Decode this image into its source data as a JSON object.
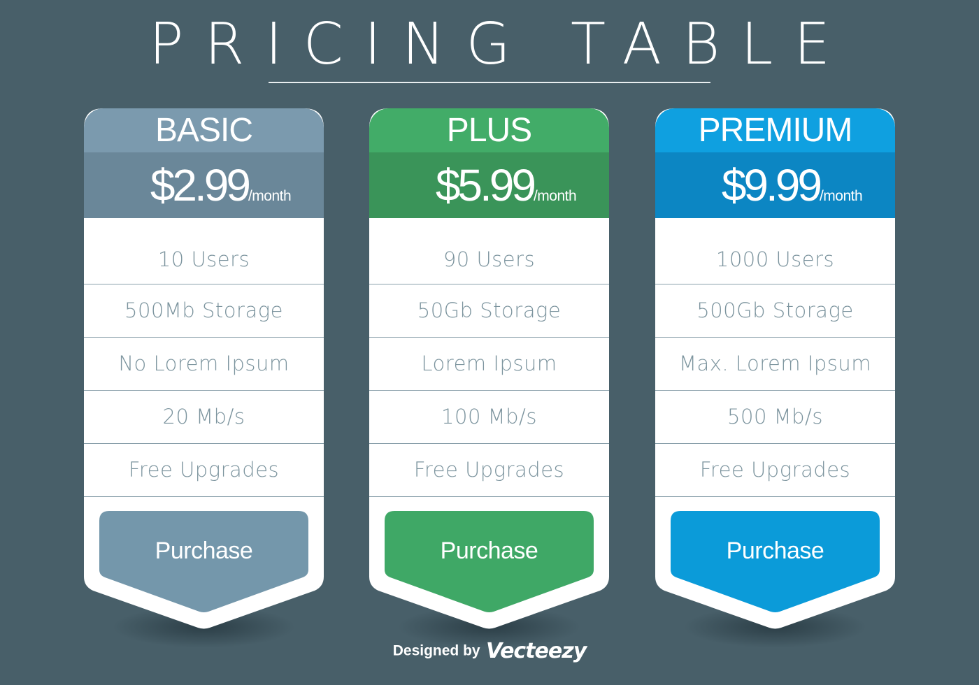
{
  "title": "PRICING TABLE",
  "plans": [
    {
      "name": "BASIC",
      "price": "$2.99",
      "period": "/month",
      "colors": {
        "name_bg": "#7b9aae",
        "price_bg": "#6a8799",
        "button_bg": "#7497ab"
      },
      "features": [
        "10 Users",
        "500Mb Storage",
        "No Lorem Ipsum",
        "20 Mb/s",
        "Free Upgrades"
      ],
      "button_label": "Purchase"
    },
    {
      "name": "PLUS",
      "price": "$5.99",
      "period": "/month",
      "colors": {
        "name_bg": "#42ac68",
        "price_bg": "#3a9459",
        "button_bg": "#3fa866"
      },
      "features": [
        "90 Users",
        "50Gb Storage",
        "Lorem Ipsum",
        "100 Mb/s",
        "Free Upgrades"
      ],
      "button_label": "Purchase"
    },
    {
      "name": "PREMIUM",
      "price": "$9.99",
      "period": "/month",
      "colors": {
        "name_bg": "#0fa0e0",
        "price_bg": "#0c86c3",
        "button_bg": "#0b9bd9"
      },
      "features": [
        "1000 Users",
        "500Gb Storage",
        "Max. Lorem Ipsum",
        "500 Mb/s",
        "Free Upgrades"
      ],
      "button_label": "Purchase"
    }
  ],
  "credit": {
    "prefix": "Designed by",
    "brand": "Vecteezy"
  }
}
